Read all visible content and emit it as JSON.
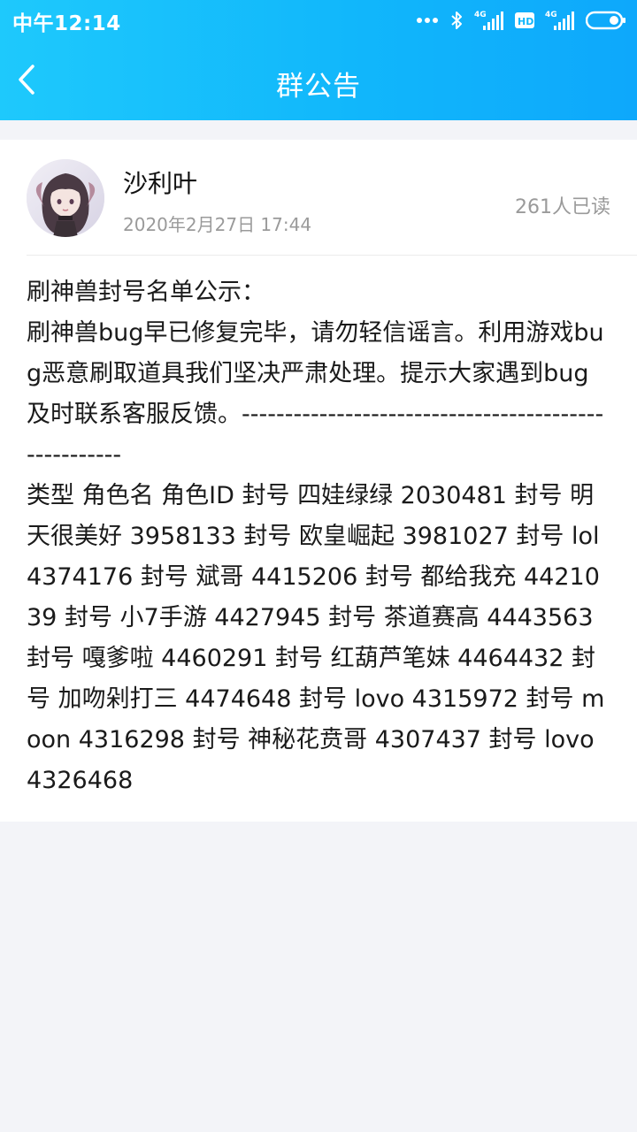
{
  "status_bar": {
    "time": "中午12:14",
    "icons": [
      "more-dots-icon",
      "bluetooth-icon",
      "signal-4g-icon",
      "hd-icon",
      "signal-4g-icon",
      "battery-icon"
    ],
    "network_label": "4G",
    "hd_label": "HD"
  },
  "header": {
    "title": "群公告",
    "back_icon": "chevron-left-icon",
    "gradient_start": "#1ec9fc",
    "gradient_end": "#0ea8fb"
  },
  "post": {
    "author": "沙利叶",
    "date": "2020年2月27日 17:44",
    "read_count": "261人已读",
    "lines": [
      "刷神兽封号名单公示：",
      "刷神兽bug早已修复完毕，请勿轻信谣言。利用游戏bug恶意刷取道具我们坚决严肃处理。提示大家遇到bug及时联系客服反馈。-----------------------------------------------------",
      "类型 角色名 角色ID 封号 四娃绿绿 2030481 封号 明天很美好 3958133 封号 欧皇崛起 3981027 封号 lol 4374176 封号 斌哥 4415206 封号 都给我充 4421039 封号 小7手游 4427945 封号 茶道赛高 4443563 封号 嘎爹啦 4460291 封号 红葫芦笔妹 4464432 封号 加吻剁打三 4474648 封号 lovo 4315972 封号 moon 4316298 封号 神秘花贲哥 4307437 封号 lovo 4326468"
    ]
  },
  "colors": {
    "page_background": "#f3f4f8",
    "card_background": "#ffffff",
    "secondary_text": "#9a9a9a"
  }
}
